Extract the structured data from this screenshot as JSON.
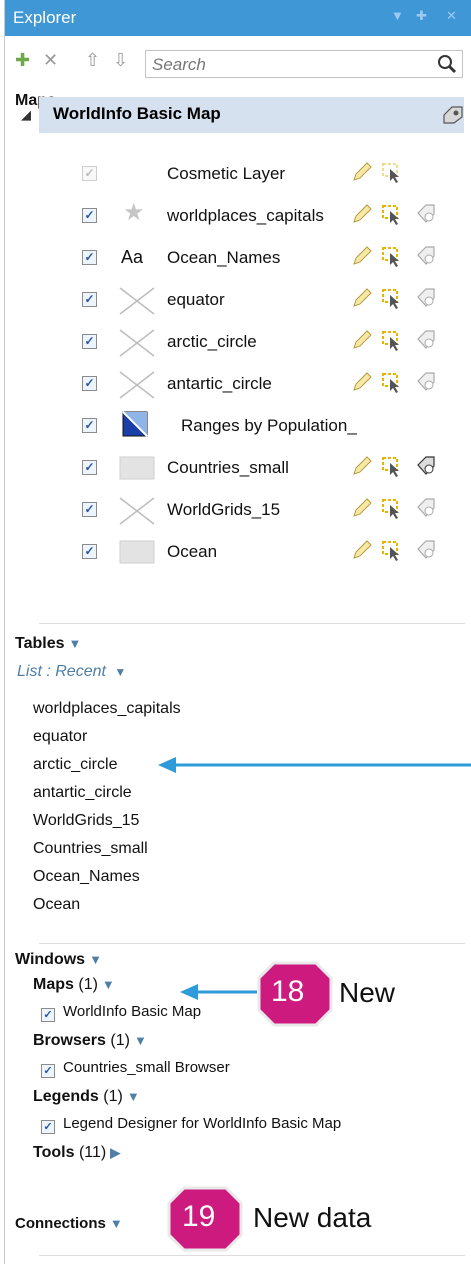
{
  "titlebar": {
    "title": "Explorer"
  },
  "toolbar": {
    "search_placeholder": "Search"
  },
  "maps_section": {
    "label": "Maps"
  },
  "map": {
    "name": "WorldInfo Basic Map"
  },
  "layers": [
    {
      "name": "Cosmetic Layer",
      "checked": true,
      "enabled": false,
      "icon": "none"
    },
    {
      "name": "worldplaces_capitals",
      "checked": true,
      "enabled": true,
      "icon": "star-icon"
    },
    {
      "name": "Ocean_Names",
      "checked": true,
      "enabled": true,
      "icon": "text-label-icon",
      "icon_text": "Aa"
    },
    {
      "name": "equator",
      "checked": true,
      "enabled": true,
      "icon": "line-icon"
    },
    {
      "name": "arctic_circle",
      "checked": true,
      "enabled": true,
      "icon": "line-icon"
    },
    {
      "name": "antartic_circle",
      "checked": true,
      "enabled": true,
      "icon": "line-icon"
    },
    {
      "name": "Ranges by Population_",
      "checked": true,
      "enabled": true,
      "icon": "thematic-icon"
    },
    {
      "name": "Countries_small",
      "checked": true,
      "enabled": true,
      "icon": "region-icon"
    },
    {
      "name": "WorldGrids_15",
      "checked": true,
      "enabled": true,
      "icon": "line-icon"
    },
    {
      "name": "Ocean",
      "checked": true,
      "enabled": true,
      "icon": "region-icon"
    }
  ],
  "tables_section": {
    "label": "Tables",
    "list_mode": "List : Recent",
    "items": [
      "worldplaces_capitals",
      "equator",
      "arctic_circle",
      "antartic_circle",
      "WorldGrids_15",
      "Countries_small",
      "Ocean_Names",
      "Ocean"
    ]
  },
  "windows_section": {
    "label": "Windows",
    "categories": [
      {
        "name": "Maps",
        "count": "(1)",
        "items": [
          "WorldInfo Basic Map"
        ]
      },
      {
        "name": "Browsers",
        "count": "(1)",
        "items": [
          "Countries_small Browser"
        ]
      },
      {
        "name": "Legends",
        "count": "(1)",
        "items": [
          "Legend Designer for WorldInfo Basic Map"
        ]
      },
      {
        "name": "Tools",
        "count": "(11)",
        "items": []
      }
    ]
  },
  "connections_section": {
    "label": "Connections"
  },
  "callouts": [
    {
      "number": "18",
      "text": "New"
    },
    {
      "number": "19",
      "text": "New data"
    }
  ],
  "colors": {
    "titlebar": "#3f97d6",
    "selection": "#d6e1ef",
    "accent": "#4f7fa6",
    "callout_badge": "#cc1a7f",
    "arrow": "#2e9ad8"
  }
}
